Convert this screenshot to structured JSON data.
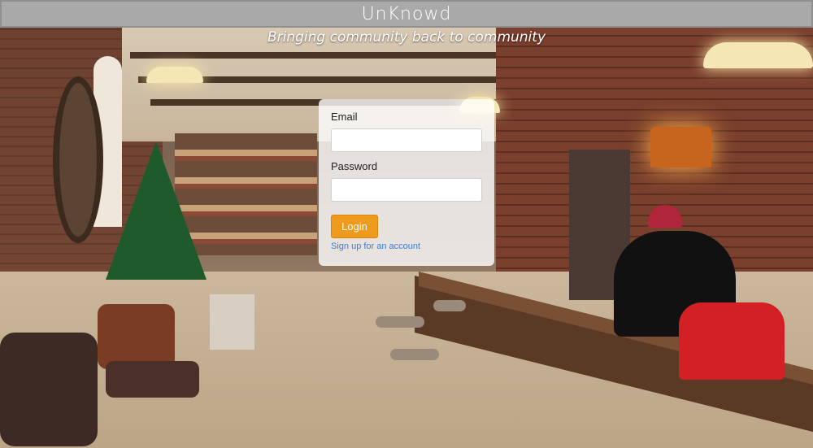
{
  "app": {
    "title": "UnKnowd",
    "tagline": "Bringing community back to community"
  },
  "login_form": {
    "email_label": "Email",
    "email_value": "",
    "password_label": "Password",
    "password_value": "",
    "login_label": "Login",
    "signup_link": "Sign up for an account"
  },
  "colors": {
    "topbar": "#a9a9a9",
    "login_button": "#ee9a1c",
    "link": "#3a7bd5"
  }
}
